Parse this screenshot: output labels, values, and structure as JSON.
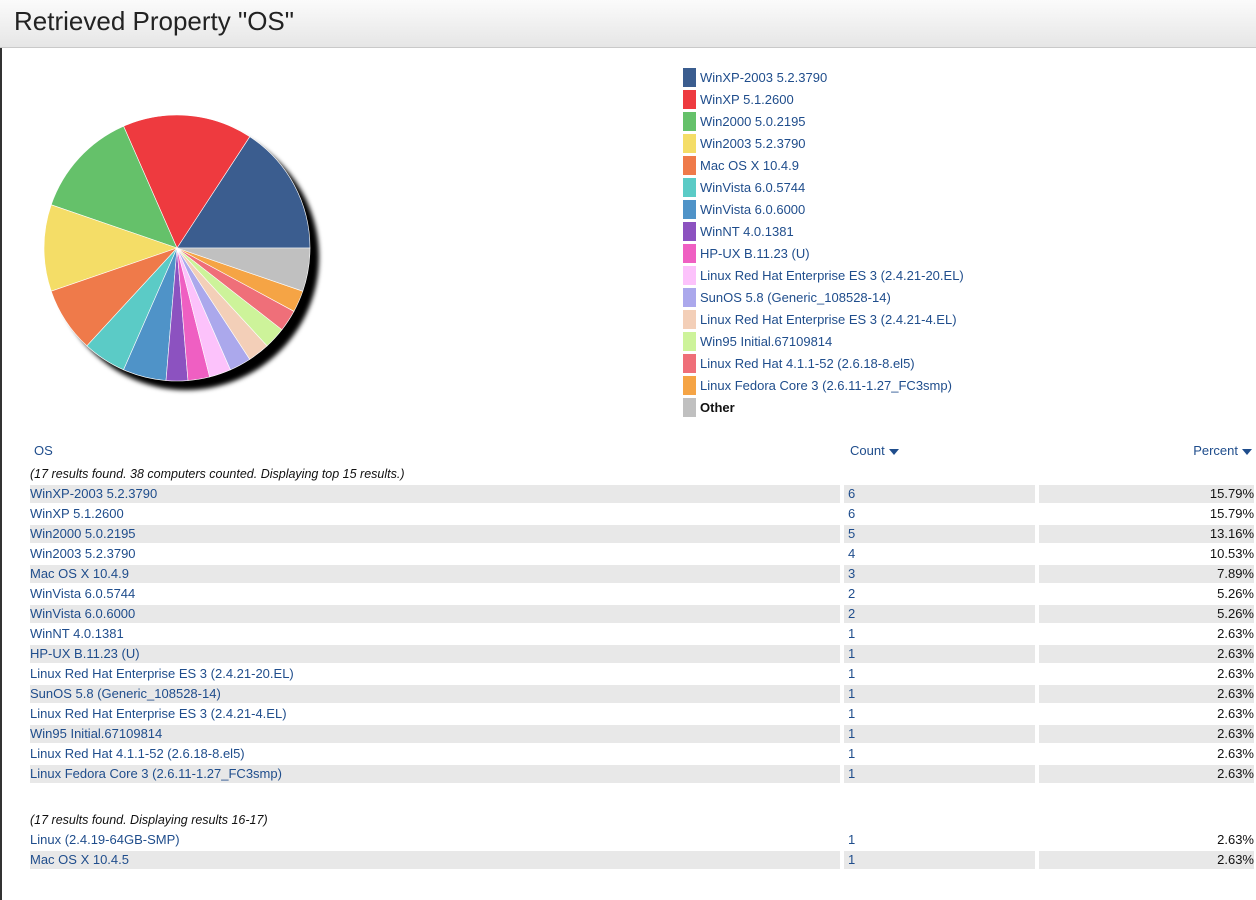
{
  "title": "Retrieved Property \"OS\"",
  "legend": [
    {
      "label": "WinXP-2003 5.2.3790",
      "color": "#3b5d8f"
    },
    {
      "label": "WinXP 5.1.2600",
      "color": "#ee3a3f"
    },
    {
      "label": "Win2000 5.0.2195",
      "color": "#65c16a"
    },
    {
      "label": "Win2003 5.2.3790",
      "color": "#f4dd67"
    },
    {
      "label": "Mac OS X 10.4.9",
      "color": "#ef7a4a"
    },
    {
      "label": "WinVista 6.0.5744",
      "color": "#5bcbc6"
    },
    {
      "label": "WinVista 6.0.6000",
      "color": "#4f93c8"
    },
    {
      "label": "WinNT 4.0.1381",
      "color": "#8c52c0"
    },
    {
      "label": "HP-UX B.11.23 (U)",
      "color": "#ef5fc2"
    },
    {
      "label": "Linux Red Hat Enterprise ES 3 (2.4.21-20.EL)",
      "color": "#fcc2fb"
    },
    {
      "label": "SunOS 5.8 (Generic_108528-14)",
      "color": "#aba8ec"
    },
    {
      "label": "Linux Red Hat Enterprise ES 3 (2.4.21-4.EL)",
      "color": "#f3cfb8"
    },
    {
      "label": "Win95 Initial.67109814",
      "color": "#cdf39a"
    },
    {
      "label": "Linux Red Hat 4.1.1-52 (2.6.18-8.el5)",
      "color": "#ef6f79"
    },
    {
      "label": "Linux Fedora Core 3 (2.6.11-1.27_FC3smp)",
      "color": "#f5a445"
    },
    {
      "label": "Other",
      "color": "#c0c0c0"
    }
  ],
  "chart_data": {
    "type": "pie",
    "labels": [
      "WinXP-2003 5.2.3790",
      "WinXP 5.1.2600",
      "Win2000 5.0.2195",
      "Win2003 5.2.3790",
      "Mac OS X 10.4.9",
      "WinVista 6.0.5744",
      "WinVista 6.0.6000",
      "WinNT 4.0.1381",
      "HP-UX B.11.23 (U)",
      "Linux Red Hat Enterprise ES 3 (2.4.21-20.EL)",
      "SunOS 5.8 (Generic_108528-14)",
      "Linux Red Hat Enterprise ES 3 (2.4.21-4.EL)",
      "Win95 Initial.67109814",
      "Linux Red Hat 4.1.1-52 (2.6.18-8.el5)",
      "Linux Fedora Core 3 (2.6.11-1.27_FC3smp)",
      "Other"
    ],
    "values": [
      6,
      6,
      5,
      4,
      3,
      2,
      2,
      1,
      1,
      1,
      1,
      1,
      1,
      1,
      1,
      2
    ]
  },
  "table": {
    "headers": {
      "os": "OS",
      "count": "Count",
      "percent": "Percent"
    },
    "note1": "(17 results found. 38 computers counted. Displaying top 15 results.)",
    "rows1": [
      {
        "os": "WinXP-2003 5.2.3790",
        "count": "6",
        "percent": "15.79%"
      },
      {
        "os": "WinXP 5.1.2600",
        "count": "6",
        "percent": "15.79%"
      },
      {
        "os": "Win2000 5.0.2195",
        "count": "5",
        "percent": "13.16%"
      },
      {
        "os": "Win2003 5.2.3790",
        "count": "4",
        "percent": "10.53%"
      },
      {
        "os": "Mac OS X 10.4.9",
        "count": "3",
        "percent": "7.89%"
      },
      {
        "os": "WinVista 6.0.5744",
        "count": "2",
        "percent": "5.26%"
      },
      {
        "os": "WinVista 6.0.6000",
        "count": "2",
        "percent": "5.26%"
      },
      {
        "os": "WinNT 4.0.1381",
        "count": "1",
        "percent": "2.63%"
      },
      {
        "os": "HP-UX B.11.23 (U)",
        "count": "1",
        "percent": "2.63%"
      },
      {
        "os": "Linux Red Hat Enterprise ES 3 (2.4.21-20.EL)",
        "count": "1",
        "percent": "2.63%"
      },
      {
        "os": "SunOS 5.8 (Generic_108528-14)",
        "count": "1",
        "percent": "2.63%"
      },
      {
        "os": "Linux Red Hat Enterprise ES 3 (2.4.21-4.EL)",
        "count": "1",
        "percent": "2.63%"
      },
      {
        "os": "Win95 Initial.67109814",
        "count": "1",
        "percent": "2.63%"
      },
      {
        "os": "Linux Red Hat 4.1.1-52 (2.6.18-8.el5)",
        "count": "1",
        "percent": "2.63%"
      },
      {
        "os": "Linux Fedora Core 3 (2.6.11-1.27_FC3smp)",
        "count": "1",
        "percent": "2.63%"
      }
    ],
    "note2": "(17 results found. Displaying results 16-17)",
    "rows2": [
      {
        "os": "Linux (2.4.19-64GB-SMP)",
        "count": "1",
        "percent": "2.63%"
      },
      {
        "os": "Mac OS X 10.4.5",
        "count": "1",
        "percent": "2.63%"
      }
    ]
  }
}
